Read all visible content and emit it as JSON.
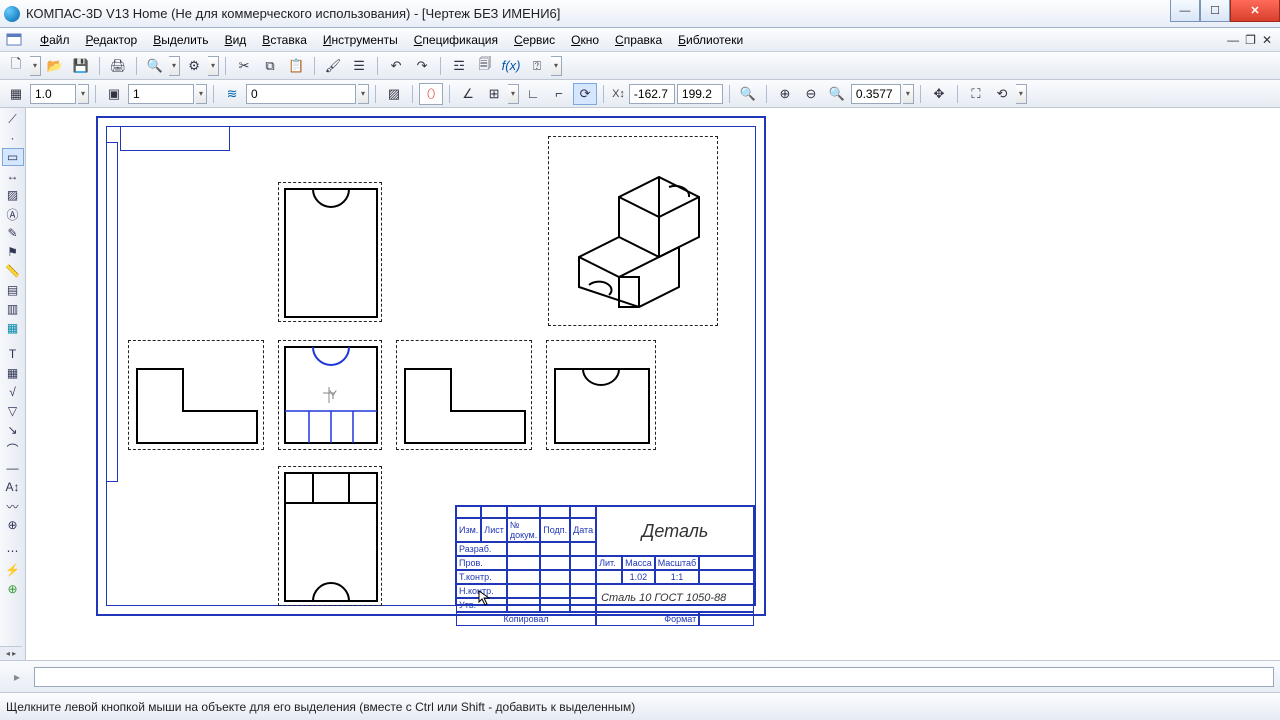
{
  "window": {
    "title": "КОМПАС-3D V13 Home (Не для коммерческого использования) - [Чертеж БЕЗ ИМЕНИ6]"
  },
  "menu": {
    "file": "Файл",
    "editor": "Редактор",
    "select": "Выделить",
    "view": "Вид",
    "insert": "Вставка",
    "tools": "Инструменты",
    "spec": "Спецификация",
    "service": "Сервис",
    "window": "Окно",
    "help": "Справка",
    "libs": "Библиотеки"
  },
  "toolbar2": {
    "linewidth": "1.0",
    "layer": "1",
    "style": "0",
    "coord_x": "-162.7",
    "coord_y": "199.2",
    "zoom": "0.3577"
  },
  "titleblock": {
    "name": "Деталь",
    "material": "Сталь 10  ГОСТ 1050-88",
    "scale": "1:1",
    "mass_hdr": "Масса",
    "mass": "1.02",
    "sheet_hdr": "Лист",
    "lit_hdr": "Лит.",
    "format_hdr": "Формат",
    "scale_hdr": "Масштаб",
    "copied": "Копировал",
    "h_izm": "Изм.",
    "h_list": "Лист",
    "h_doc": "№ докум.",
    "h_sign": "Подп.",
    "h_date": "Дата",
    "r_razrab": "Разраб.",
    "r_prov": "Пров.",
    "r_tkontr": "Т.контр.",
    "r_nkontr": "Н.контр.",
    "r_utv": "Утв."
  },
  "status": {
    "hint": "Щелкните левой кнопкой мыши на объекте для его выделения (вместе с Ctrl или Shift - добавить к выделенным)"
  },
  "icons": {
    "fx": "f(x)"
  }
}
